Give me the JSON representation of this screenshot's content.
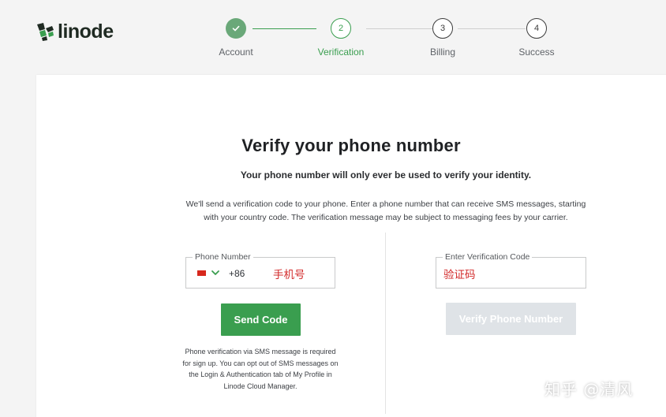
{
  "brand": {
    "name": "linode",
    "logo_color": "#3a9e4f"
  },
  "stepper": {
    "steps": [
      {
        "number": "✓",
        "label": "Account",
        "state": "done"
      },
      {
        "number": "2",
        "label": "Verification",
        "state": "current"
      },
      {
        "number": "3",
        "label": "Billing",
        "state": "future"
      },
      {
        "number": "4",
        "label": "Success",
        "state": "future"
      }
    ]
  },
  "main": {
    "title": "Verify your phone number",
    "subtitle": "Your phone number will only ever be used to verify your identity.",
    "description_line1": "We'll send a verification code to your phone. Enter a phone number that can receive SMS messages, starting",
    "description_line2": "with your country code. The verification message may be subject to messaging fees by your carrier."
  },
  "phone": {
    "label": "Phone Number",
    "country_flag": "cn-flag-icon",
    "dial_code": "+86",
    "value": "手机号",
    "send_label": "Send Code",
    "note_lines": [
      "Phone verification via SMS message is required",
      "for sign up. You can opt out of SMS messages on",
      "the Login & Authentication tab of My Profile in",
      "Linode Cloud Manager."
    ]
  },
  "verification": {
    "label": "Enter Verification Code",
    "value": "验证码",
    "verify_label": "Verify Phone Number"
  },
  "watermark": "知乎 @清风",
  "colors": {
    "accent": "#3a9e4f",
    "done_step": "#6aa879",
    "disabled_button": "#dfe3e7",
    "placeholder_red": "#d22a2a"
  }
}
